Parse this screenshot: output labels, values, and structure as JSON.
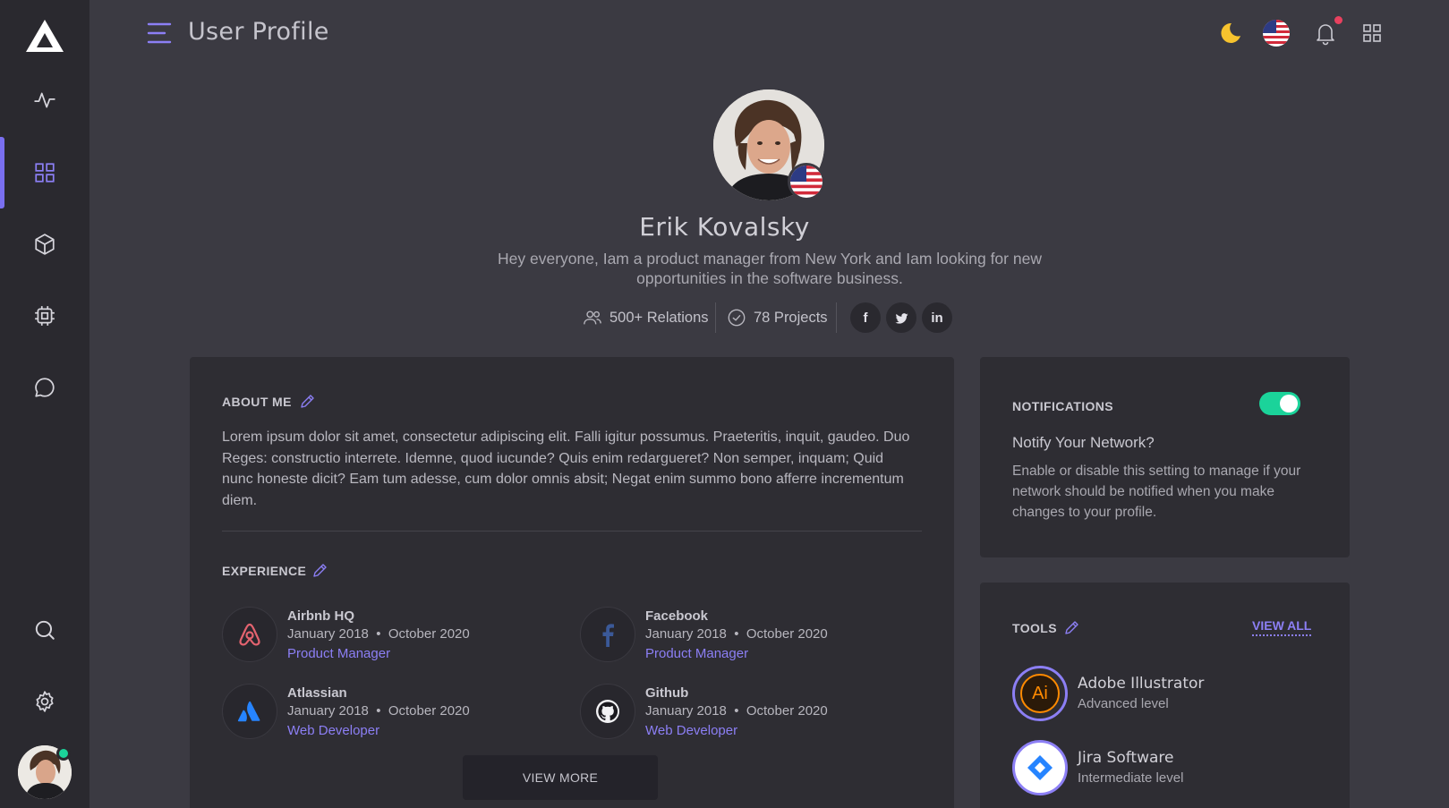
{
  "header": {
    "title": "User Profile",
    "icons": [
      "menu-icon",
      "moon-icon",
      "us-flag-icon",
      "bell-icon",
      "apps-grid-icon"
    ]
  },
  "sidebar": {
    "items": [
      {
        "icon": "activity-icon"
      },
      {
        "icon": "dashboard-grid-icon",
        "active": true
      },
      {
        "icon": "cube-icon"
      },
      {
        "icon": "cpu-icon"
      },
      {
        "icon": "chat-icon"
      },
      {
        "icon": "search-icon"
      },
      {
        "icon": "settings-icon"
      }
    ]
  },
  "profile": {
    "name": "Erik Kovalsky",
    "bio": "Hey everyone, Iam a product manager from New York and Iam looking for new opportunities in the software business.",
    "relations": "500+ Relations",
    "projects": "78 Projects",
    "social": {
      "facebook": "f",
      "linkedin": "in"
    }
  },
  "about": {
    "title": "ABOUT ME",
    "text": "Lorem ipsum dolor sit amet, consectetur adipiscing elit. Falli igitur possumus. Praeteritis, inquit, gaudeo. Duo Reges: constructio interrete. Idemne, quod iucunde? Quis enim redargueret? Non semper, inquam; Quid nunc honeste dicit? Eam tum adesse, cum dolor omnis absit; Negat enim summo bono afferre incrementum diem."
  },
  "experience": {
    "title": "EXPERIENCE",
    "items": [
      {
        "company": "Airbnb HQ",
        "start": "January 2018",
        "end": "October 2020",
        "role": "Product Manager",
        "icon": "airbnb-icon"
      },
      {
        "company": "Facebook",
        "start": "January 2018",
        "end": "October 2020",
        "role": "Product Manager",
        "icon": "facebook-icon"
      },
      {
        "company": "Atlassian",
        "start": "January 2018",
        "end": "October 2020",
        "role": "Web Developer",
        "icon": "atlassian-icon"
      },
      {
        "company": "Github",
        "start": "January 2018",
        "end": "October 2020",
        "role": "Web Developer",
        "icon": "github-icon"
      }
    ],
    "view_more": "VIEW MORE"
  },
  "notifications": {
    "title": "NOTIFICATIONS",
    "enabled": true,
    "question": "Notify Your Network?",
    "text": "Enable or disable this setting to manage if your network should be notified when you make changes to your profile."
  },
  "tools": {
    "title": "TOOLS",
    "view_all": "VIEW ALL",
    "items": [
      {
        "name": "Adobe Illustrator",
        "level": "Advanced level",
        "logo_text": "Ai",
        "icon": "adobe-illustrator-icon"
      },
      {
        "name": "Jira Software",
        "level": "Intermediate level",
        "icon": "jira-icon"
      }
    ]
  },
  "colors": {
    "accent": "#8c7ff5",
    "toggle_on": "#1bd39a",
    "background": "#3b3a42",
    "sidebar": "#2a292f",
    "card": "#2e2d33"
  }
}
